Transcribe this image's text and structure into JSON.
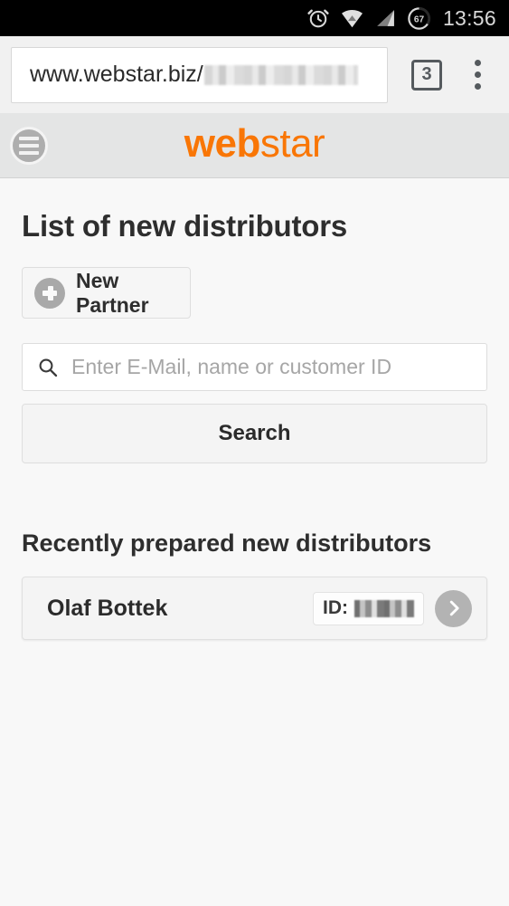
{
  "status_bar": {
    "time": "13:56",
    "battery_level": "67",
    "icons": [
      "alarm-clock-icon",
      "wifi-icon",
      "cellular-signal-icon",
      "battery-icon"
    ]
  },
  "browser": {
    "url_visible": "www.webstar.biz/",
    "url_redacted": true,
    "tab_count": "3",
    "overflow_menu": "more-options-icon"
  },
  "site_header": {
    "menu_icon": "hamburger-menu-icon",
    "logo_bold": "web",
    "logo_light": "star",
    "logo_color": "#f97605"
  },
  "main": {
    "page_title": "List of new distributors",
    "new_partner_button": "New Partner",
    "search": {
      "placeholder": "Enter E-Mail, name or customer ID",
      "value": "",
      "icon": "search-icon",
      "button_label": "Search"
    },
    "section_title": "Recently prepared new distributors",
    "distributors": [
      {
        "name": "Olaf Bottek",
        "id_label": "ID:",
        "id_value_redacted": true,
        "action_icon": "chevron-right-icon"
      }
    ]
  }
}
